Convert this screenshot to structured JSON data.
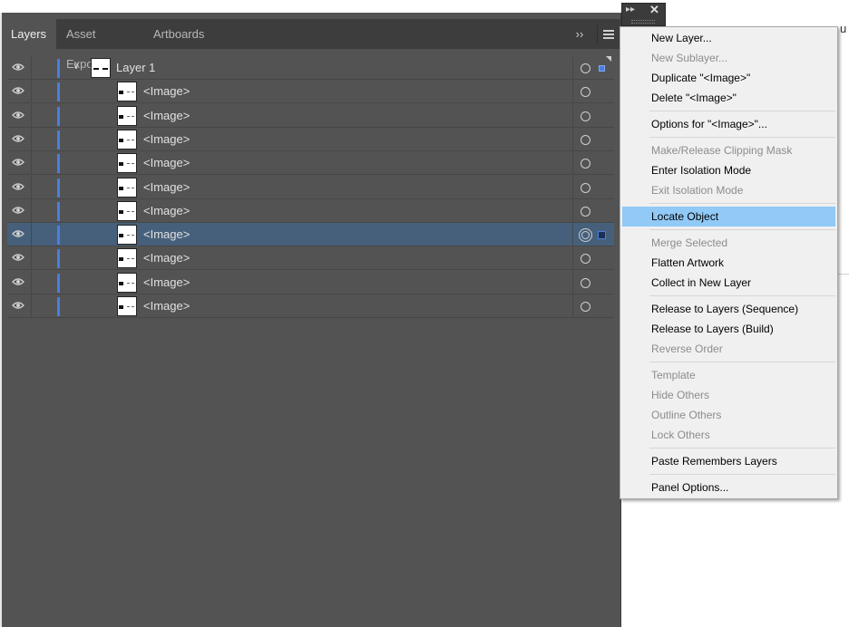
{
  "background_doc_text": "u",
  "panel": {
    "tabs": [
      {
        "label": "Layers",
        "active": true
      },
      {
        "label": "Asset Export",
        "active": false
      },
      {
        "label": "Artboards",
        "active": false
      }
    ],
    "expand_icon": "double-chevron-right-icon",
    "menu_icon": "hamburger-icon",
    "accent_color": "#4a7ee0",
    "layer": {
      "label": "Layer 1",
      "expanded": true
    },
    "items": [
      {
        "label": "<Image>",
        "selected": false
      },
      {
        "label": "<Image>",
        "selected": false
      },
      {
        "label": "<Image>",
        "selected": false
      },
      {
        "label": "<Image>",
        "selected": false
      },
      {
        "label": "<Image>",
        "selected": false
      },
      {
        "label": "<Image>",
        "selected": false
      },
      {
        "label": "<Image>",
        "selected": true
      },
      {
        "label": "<Image>",
        "selected": false
      },
      {
        "label": "<Image>",
        "selected": false
      },
      {
        "label": "<Image>",
        "selected": false
      }
    ]
  },
  "mini_bar": {
    "collapse_icon": "double-chevron-right-icon",
    "close_icon": "close-icon"
  },
  "menu": {
    "items": [
      {
        "label": "New Layer...",
        "enabled": true
      },
      {
        "label": "New Sublayer...",
        "enabled": false
      },
      {
        "label": "Duplicate \"<Image>\"",
        "enabled": true
      },
      {
        "label": "Delete \"<Image>\"",
        "enabled": true
      },
      {
        "label": "Options for \"<Image>\"...",
        "enabled": true
      },
      {
        "label": "Make/Release Clipping Mask",
        "enabled": false
      },
      {
        "label": "Enter Isolation Mode",
        "enabled": true
      },
      {
        "label": "Exit Isolation Mode",
        "enabled": false
      },
      {
        "label": "Locate Object",
        "enabled": true,
        "highlighted": true
      },
      {
        "label": "Merge Selected",
        "enabled": false
      },
      {
        "label": "Flatten Artwork",
        "enabled": true
      },
      {
        "label": "Collect in New Layer",
        "enabled": true
      },
      {
        "label": "Release to Layers (Sequence)",
        "enabled": true
      },
      {
        "label": "Release to Layers (Build)",
        "enabled": true
      },
      {
        "label": "Reverse Order",
        "enabled": false
      },
      {
        "label": "Template",
        "enabled": false
      },
      {
        "label": "Hide Others",
        "enabled": false
      },
      {
        "label": "Outline Others",
        "enabled": false
      },
      {
        "label": "Lock Others",
        "enabled": false
      },
      {
        "label": "Paste Remembers Layers",
        "enabled": true
      },
      {
        "label": "Panel Options...",
        "enabled": true
      }
    ]
  }
}
